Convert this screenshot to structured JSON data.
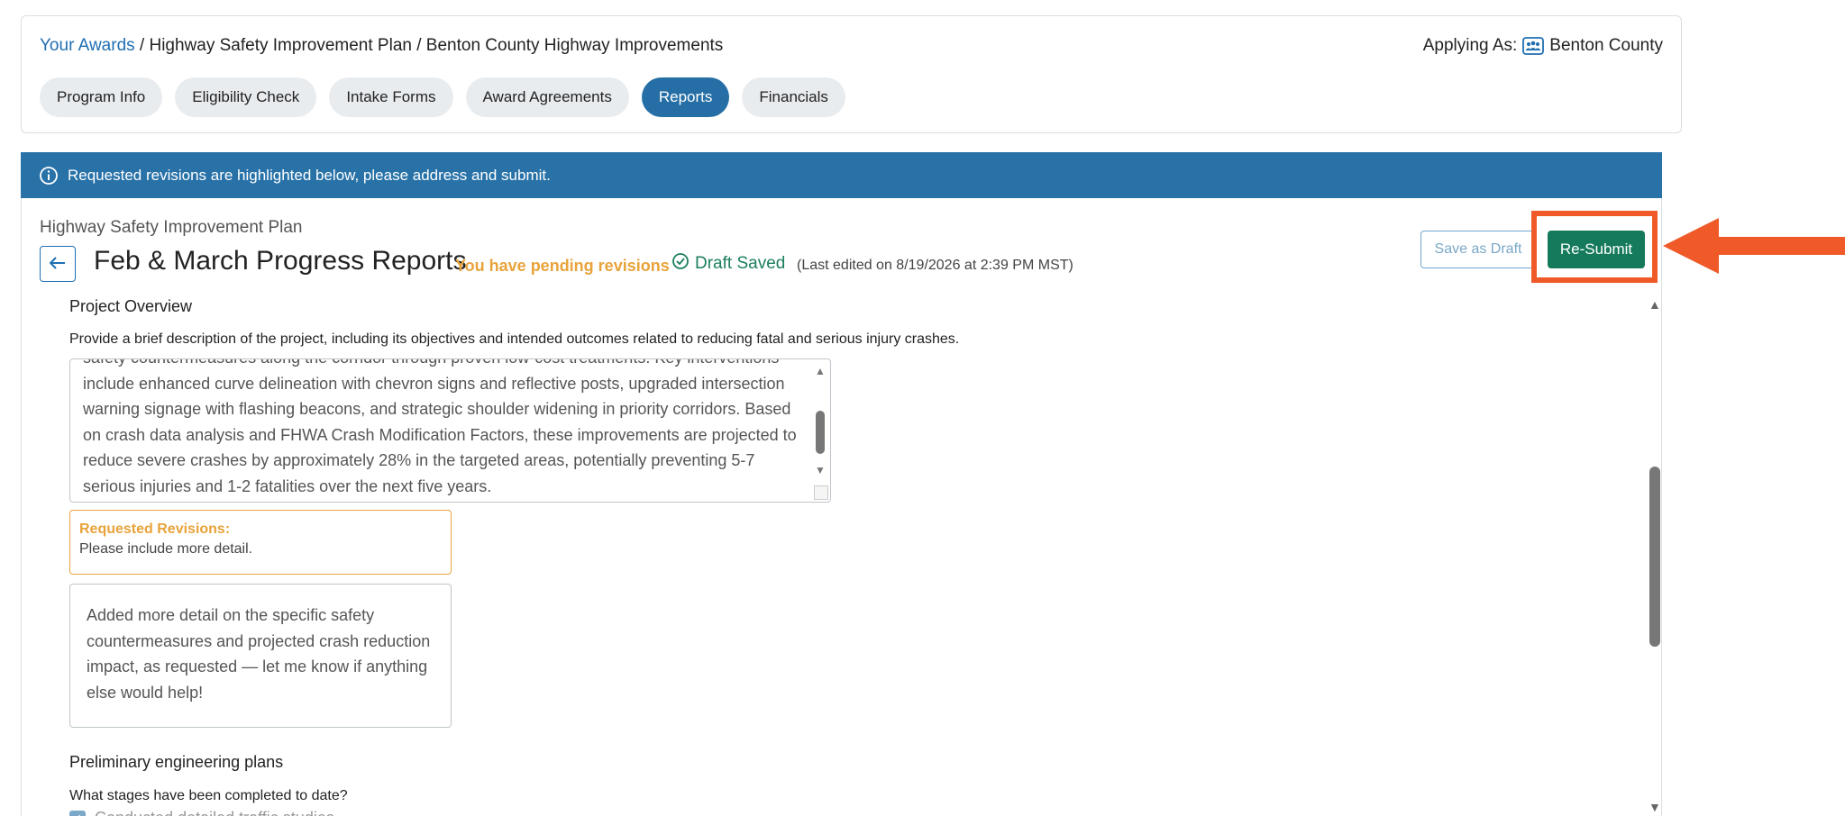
{
  "breadcrumb": {
    "root": "Your Awards",
    "program": "Highway Safety Improvement Plan",
    "project": "Benton County Highway Improvements",
    "separator": "/"
  },
  "applying_as": {
    "label": "Applying As:",
    "org": "Benton County",
    "icon": "organization-icon"
  },
  "tabs": [
    {
      "label": "Program Info",
      "active": false
    },
    {
      "label": "Eligibility Check",
      "active": false
    },
    {
      "label": "Intake Forms",
      "active": false
    },
    {
      "label": "Award Agreements",
      "active": false
    },
    {
      "label": "Reports",
      "active": true
    },
    {
      "label": "Financials",
      "active": false
    }
  ],
  "banner": {
    "text": "Requested revisions are highlighted below, please address and submit.",
    "icon": "info-icon",
    "color": "#2872a8"
  },
  "report": {
    "program_name": "Highway Safety Improvement Plan",
    "title": "Feb & March Progress Reports",
    "pending": "You have pending revisions",
    "draft_saved": "Draft Saved",
    "last_edited": "(Last edited on 8/19/2026 at 2:39 PM MST)"
  },
  "actions": {
    "save_draft": "Save as Draft",
    "resubmit": "Re-Submit",
    "resubmit_color": "#157a5c",
    "highlight_color": "#f05a28"
  },
  "sections": {
    "overview": {
      "title": "Project Overview",
      "question": "Provide a brief description of the project, including its objectives and intended outcomes related to reducing fatal and serious injury crashes.",
      "answer": "safety countermeasures along the corridor through proven low-cost treatments. Key interventions include enhanced curve delineation with chevron signs and reflective posts, upgraded intersection warning signage with flashing beacons, and strategic shoulder widening in priority corridors. Based on crash data analysis and FHWA Crash Modification Factors, these improvements are projected to reduce severe crashes by approximately 28% in the targeted areas, potentially preventing 5-7 serious injuries and 1-2 fatalities over the next five years.",
      "revisions_label": "Requested Revisions:",
      "revisions_text": "Please include more detail.",
      "response": "Added more detail on the specific safety countermeasures and projected crash reduction impact, as requested — let me know if anything else would help!"
    },
    "engineering": {
      "title": "Preliminary engineering plans",
      "question": "What stages have been completed to date?",
      "option_1": "Conducted detailed traffic studies"
    }
  }
}
